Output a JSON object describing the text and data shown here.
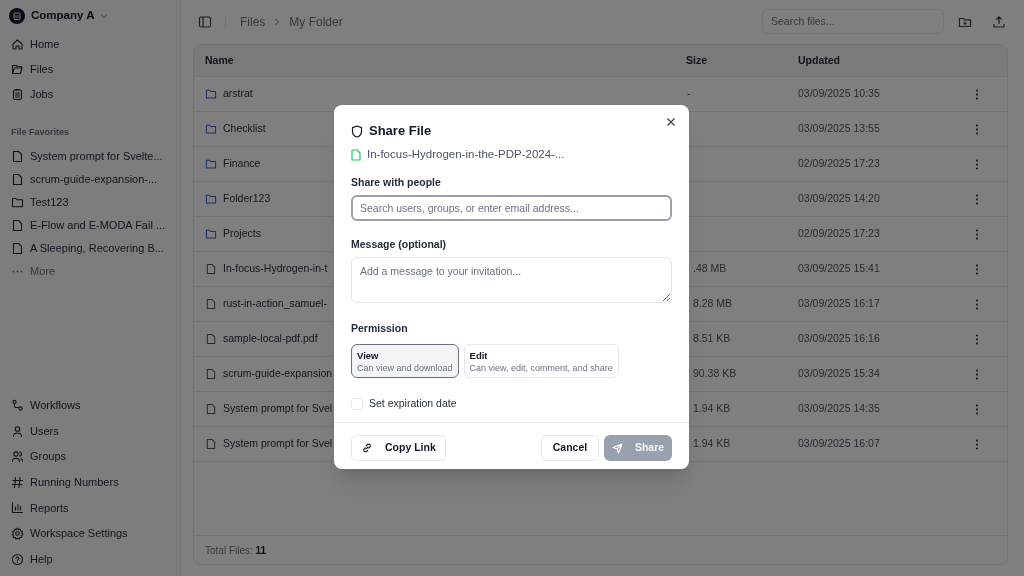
{
  "sidebar": {
    "workspace": "Company A",
    "nav": [
      {
        "label": "Home"
      },
      {
        "label": "Files"
      },
      {
        "label": "Jobs"
      }
    ],
    "favorites_title": "File Favorites",
    "favorites": [
      {
        "kind": "file",
        "label": "System prompt for Svelte..."
      },
      {
        "kind": "file",
        "label": "scrum-guide-expansion-..."
      },
      {
        "kind": "folder",
        "label": "Test123"
      },
      {
        "kind": "file",
        "label": "E-Flow and E-MODA Fail ..."
      },
      {
        "kind": "file",
        "label": "A Sleeping, Recovering B..."
      }
    ],
    "more": "More",
    "bottom_nav": [
      {
        "label": "Workflows"
      },
      {
        "label": "Users"
      },
      {
        "label": "Groups"
      },
      {
        "label": "Running Numbers"
      },
      {
        "label": "Reports"
      },
      {
        "label": "Workspace Settings"
      },
      {
        "label": "Help"
      }
    ]
  },
  "header": {
    "breadcrumbs": [
      "Files",
      "My Folder"
    ],
    "search": {
      "placeholder": "Search files..."
    }
  },
  "table": {
    "columns": [
      "Name",
      "Size",
      "Updated"
    ],
    "rows": [
      {
        "kind": "folder",
        "name": "arstrat",
        "size": "-",
        "updated": "03/09/2025 10:35"
      },
      {
        "kind": "folder",
        "name": "Checklist",
        "updated": "03/09/2025 13:55"
      },
      {
        "kind": "folder",
        "name": "Finance",
        "updated": "02/09/2025 17:23"
      },
      {
        "kind": "folder",
        "name": "Folder123",
        "updated": "03/09/2025 14:20"
      },
      {
        "kind": "folder",
        "name": "Projects",
        "updated": "02/09/2025 17:23"
      },
      {
        "kind": "file",
        "name": "In-focus-Hydrogen-in-t",
        "size": ".48 MB",
        "updated": "03/09/2025 15:41"
      },
      {
        "kind": "file",
        "name": "rust-in-action_samuel-",
        "size": "8.28 MB",
        "updated": "03/09/2025 16:17"
      },
      {
        "kind": "file",
        "name": "sample-local-pdf.pdf",
        "size": "8.51 KB",
        "updated": "03/09/2025 16:16"
      },
      {
        "kind": "file",
        "name": "scrum-guide-expansion",
        "size": "90.38 KB",
        "updated": "03/09/2025 15:34"
      },
      {
        "kind": "file",
        "name": "System prompt for Svel",
        "size": "1.94 KB",
        "updated": "03/09/2025 14:35"
      },
      {
        "kind": "file",
        "name": "System prompt for Svel",
        "size": "1.94 KB",
        "updated": "03/09/2025 16:07"
      }
    ],
    "footer": {
      "label": "Total Files:",
      "value": "11"
    }
  },
  "dialog": {
    "title": "Share File",
    "file": "In-focus-Hydrogen-in-the-PDP-2024-...",
    "share_label": "Share with people",
    "share_placeholder": "Search users, groups, or enter email address...",
    "message_label": "Message (optional)",
    "message_placeholder": "Add a message to your invitation...",
    "permission_label": "Permission",
    "permissions": [
      {
        "title": "View",
        "description": "Can view and download",
        "selected": true
      },
      {
        "title": "Edit",
        "description": "Can view, edit, comment, and share",
        "selected": false
      }
    ],
    "expiration": {
      "label": "Set expiration date",
      "checked": false
    },
    "copy_link": "Copy Link",
    "cancel": "Cancel",
    "share": {
      "label": "Share",
      "disabled": true
    }
  }
}
